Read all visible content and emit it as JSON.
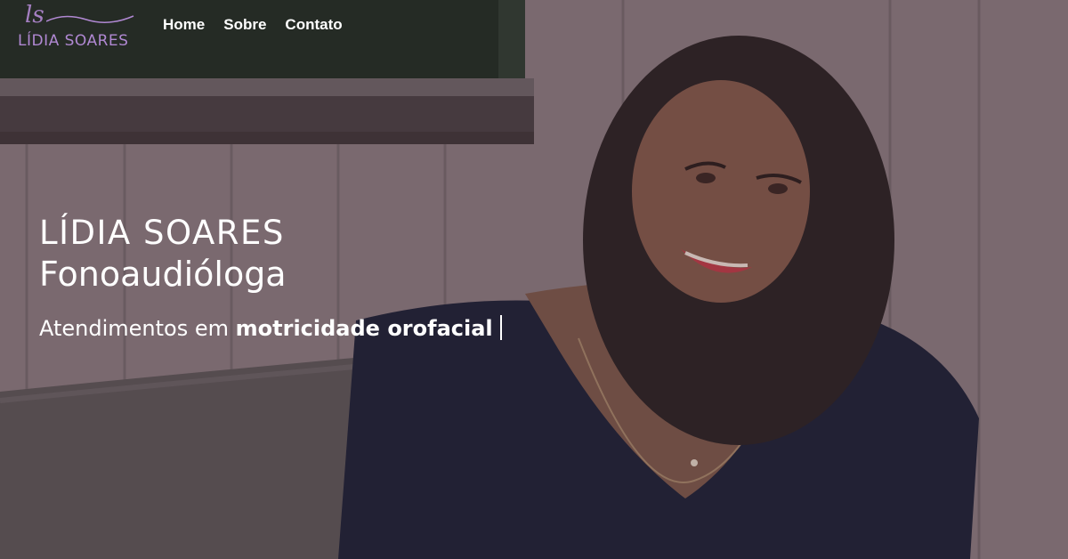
{
  "logo": {
    "script": "ls",
    "name": "LÍDIA SOARES"
  },
  "nav": {
    "items": [
      "Home",
      "Sobre",
      "Contato"
    ]
  },
  "hero": {
    "name": "LÍDIA SOARES",
    "role": "Fonoaudióloga",
    "tagline_prefix": "Atendimentos em ",
    "tagline_highlight": "motricidade orofacial"
  },
  "colors": {
    "logo": "#b088d2",
    "text": "#ffffff",
    "overlay": "#3b2a33"
  }
}
